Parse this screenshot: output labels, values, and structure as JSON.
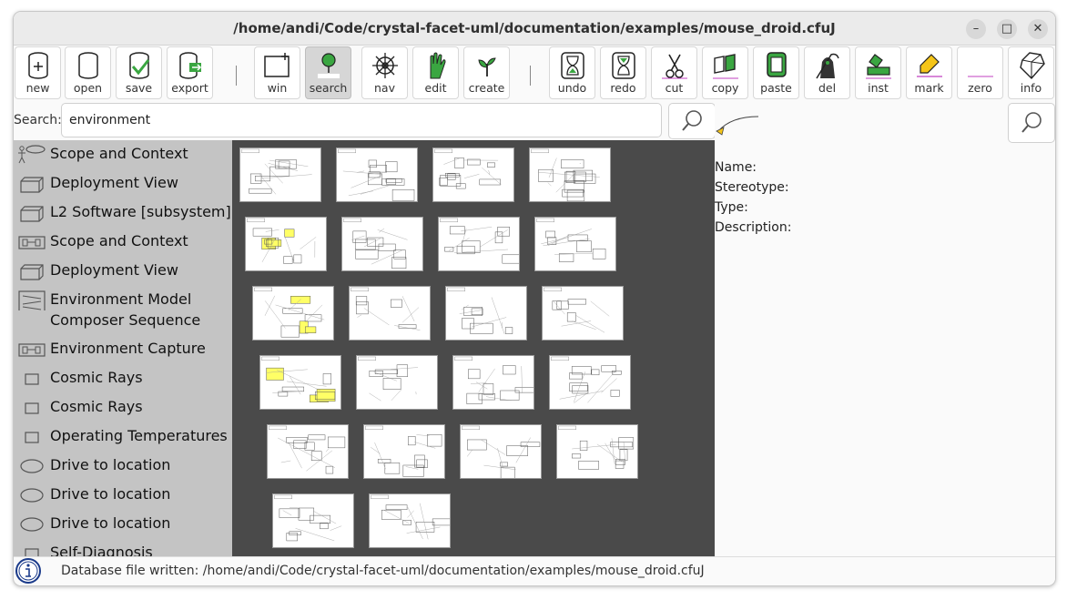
{
  "window": {
    "title": "/home/andi/Code/crystal-facet-uml/documentation/examples/mouse_droid.cfuJ",
    "minimize_glyph": "–",
    "maximize_glyph": "□",
    "close_glyph": "✕"
  },
  "toolbar": {
    "new": "new",
    "open": "open",
    "save": "save",
    "export": "export",
    "win": "win",
    "search": "search",
    "nav": "nav",
    "edit": "edit",
    "create": "create",
    "undo": "undo",
    "redo": "redo",
    "cut": "cut",
    "copy": "copy",
    "paste": "paste",
    "del": "del",
    "inst": "inst",
    "mark": "mark",
    "zero": "zero",
    "info": "info"
  },
  "search": {
    "label": "Search:",
    "value": "environment"
  },
  "results": [
    {
      "icon": "actor-usecase-icon",
      "label": "Scope and Context"
    },
    {
      "icon": "deployment-node-icon",
      "label": "Deployment View"
    },
    {
      "icon": "deployment-node-icon",
      "label": "L2 Software [subsystem]"
    },
    {
      "icon": "component-diagram-icon",
      "label": "Scope and Context"
    },
    {
      "icon": "deployment-node-icon",
      "label": "Deployment View"
    },
    {
      "icon": "sequence-diagram-icon",
      "label": "Environment Model"
    },
    {
      "icon": "sequence-diagram-icon",
      "label": "Composer Sequence"
    },
    {
      "icon": "component-diagram-icon",
      "label": "Environment Capture"
    },
    {
      "icon": "requirement-box-icon",
      "label": "Cosmic Rays"
    },
    {
      "icon": "requirement-box-icon",
      "label": "Cosmic Rays"
    },
    {
      "icon": "requirement-box-icon",
      "label": "Operating Temperatures"
    },
    {
      "icon": "usecase-ellipse-icon",
      "label": "Drive to location"
    },
    {
      "icon": "usecase-ellipse-icon",
      "label": "Drive to location"
    },
    {
      "icon": "usecase-ellipse-icon",
      "label": "Drive to location"
    },
    {
      "icon": "requirement-box-icon",
      "label": "Self-Diagnosis"
    }
  ],
  "details": {
    "name_label": "Name:",
    "stereotype_label": "Stereotype:",
    "type_label": "Type:",
    "description_label": "Description:"
  },
  "status": {
    "message": "Database file written: /home/andi/Code/crystal-facet-uml/documentation/examples/mouse_droid.cfuJ"
  },
  "colors": {
    "canvas_bg": "#4a4a4a",
    "results_bg": "#c4c4c4",
    "highlight_yellow": "#ffff66",
    "accent_green": "#3aa641"
  }
}
